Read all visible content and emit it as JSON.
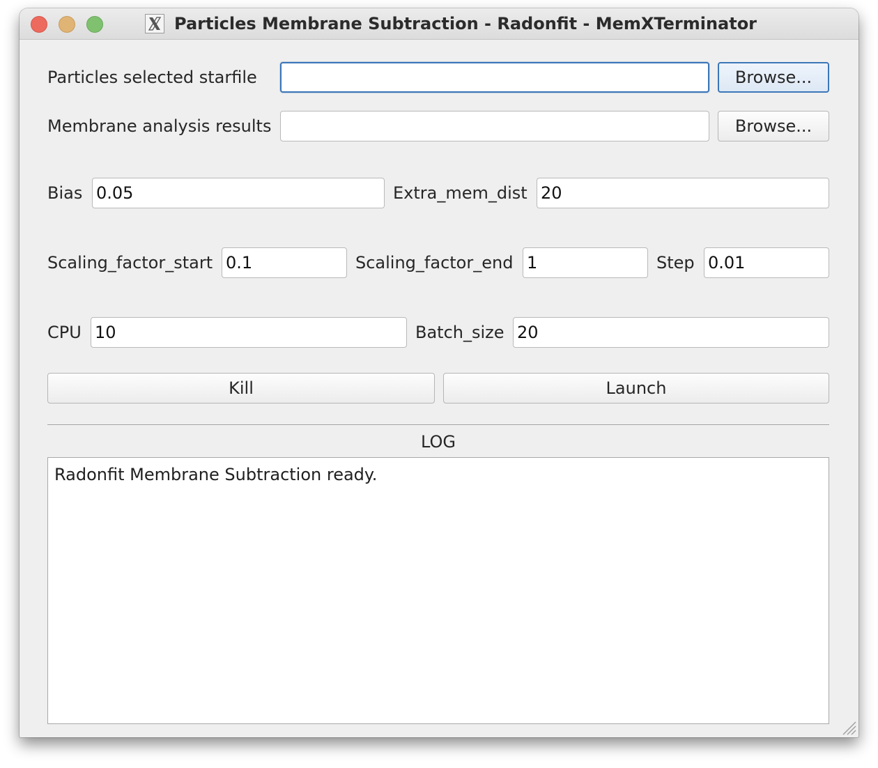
{
  "window": {
    "title": "Particles Membrane Subtraction - Radonfit - MemXTerminator"
  },
  "form": {
    "particles_label": "Particles selected starfile",
    "particles_value": "",
    "membrane_label": "Membrane analysis results",
    "membrane_value": "",
    "browse_label": "Browse...",
    "bias_label": "Bias",
    "bias_value": "0.05",
    "extra_mem_dist_label": "Extra_mem_dist",
    "extra_mem_dist_value": "20",
    "scaling_start_label": "Scaling_factor_start",
    "scaling_start_value": "0.1",
    "scaling_end_label": "Scaling_factor_end",
    "scaling_end_value": "1",
    "step_label": "Step",
    "step_value": "0.01",
    "cpu_label": "CPU",
    "cpu_value": "10",
    "batch_size_label": "Batch_size",
    "batch_size_value": "20"
  },
  "actions": {
    "kill_label": "Kill",
    "launch_label": "Launch"
  },
  "log": {
    "title": "LOG",
    "text": "Radonfit Membrane Subtraction ready."
  },
  "icons": {
    "app_icon": "x11-icon",
    "resize": "resize-grip-icon"
  },
  "colors": {
    "close": "#ed6a5e",
    "minimize": "#e0b475",
    "maximize": "#7fc16f",
    "focus": "#3b76b8",
    "window_bg": "#efefef"
  }
}
